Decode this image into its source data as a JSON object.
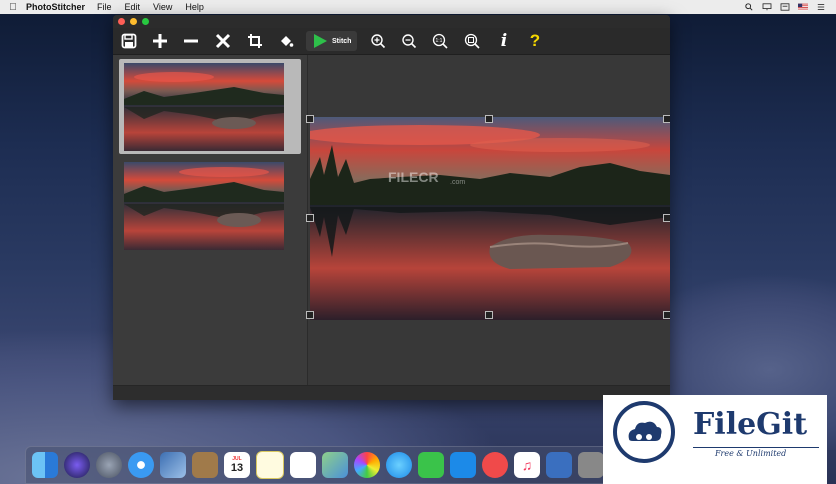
{
  "menubar": {
    "app_name": "PhotoStitcher",
    "items": [
      "File",
      "Edit",
      "View",
      "Help"
    ]
  },
  "toolbar": {
    "stitch_label": "Stitch",
    "icons": [
      "save-icon",
      "add-icon",
      "remove-icon",
      "delete-icon",
      "crop-icon",
      "fill-icon",
      "stitch-icon",
      "zoom-in-icon",
      "zoom-out-icon",
      "actual-size-icon",
      "zoom-fit-icon",
      "info-icon",
      "help-icon"
    ],
    "actual_size_label": "1:1",
    "info_label": "i",
    "help_label": "?"
  },
  "watermark": {
    "text": "FILECR",
    "sub": ".com"
  },
  "dock": {
    "calendar_month": "JUL",
    "calendar_day": "13"
  },
  "branding": {
    "name": "FileGit",
    "tagline": "Free & Unlimited"
  }
}
